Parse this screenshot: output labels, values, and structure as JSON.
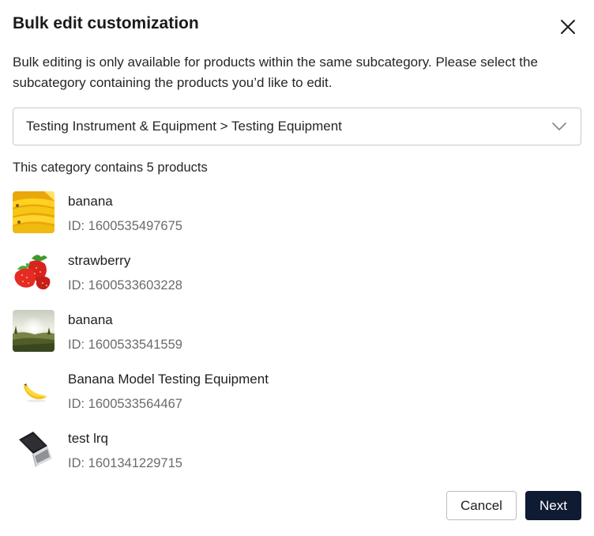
{
  "dialog": {
    "title": "Bulk edit customization",
    "description": "Bulk editing is only available for products within the same subcategory. Please select the subcategory containing the products you’d like to edit.",
    "subcategory_select": {
      "value": "Testing Instrument & Equipment > Testing Equipment"
    },
    "count_text": "This category contains 5 products",
    "products": [
      {
        "name": "banana",
        "id": "ID: 1600535497675",
        "thumbnail": "bananas-bunch-photo"
      },
      {
        "name": "strawberry",
        "id": "ID: 1600533603228",
        "thumbnail": "strawberries-photo"
      },
      {
        "name": "banana",
        "id": "ID: 1600533541559",
        "thumbnail": "landscape-sky-photo"
      },
      {
        "name": "Banana Model Testing Equipment",
        "id": "ID: 1600533564467",
        "thumbnail": "single-banana-photo"
      },
      {
        "name": "test lrq",
        "id": "ID: 1601341229715",
        "thumbnail": "laptop-photo"
      }
    ],
    "buttons": {
      "cancel": "Cancel",
      "next": "Next"
    },
    "colors": {
      "primary": "#0f1a33",
      "border": "#c9c9c9",
      "muted_text": "#6b6b6b"
    }
  }
}
